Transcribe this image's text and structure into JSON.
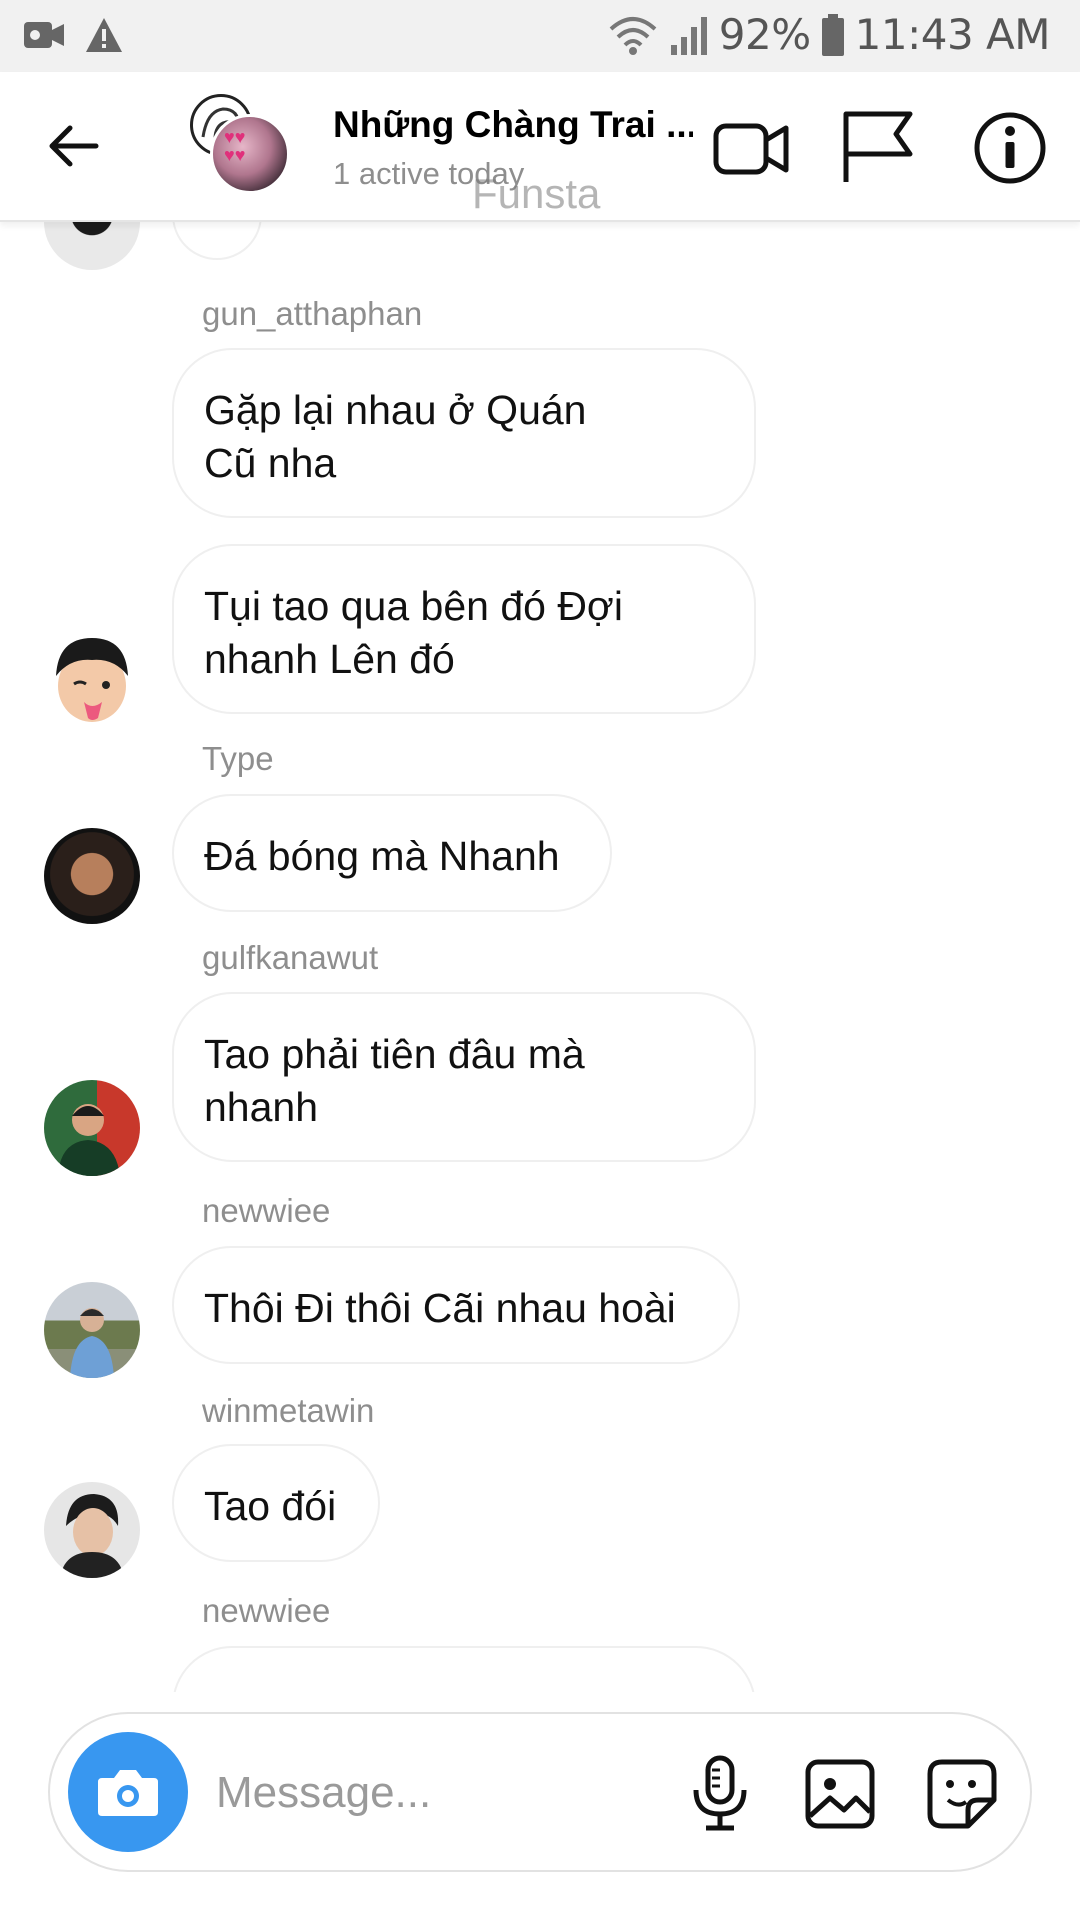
{
  "status_bar": {
    "battery_percent": "92%",
    "time": "11:43 AM",
    "left_icons": [
      "video-camera-icon",
      "warning-icon"
    ],
    "right_icons": [
      "wifi-icon",
      "signal-icon",
      "battery-icon"
    ]
  },
  "header": {
    "title": "Những Chàng Trai ...",
    "subtitle": "1 active today",
    "watermark": "Funsta",
    "icons": [
      "back-arrow-icon",
      "video-call-icon",
      "flag-icon",
      "info-icon"
    ]
  },
  "messages": [
    {
      "sender": "",
      "text": ""
    },
    {
      "sender": "gun_atthaphan",
      "lines": [
        "Gặp lại nhau ở Quán",
        "Cũ nha"
      ]
    },
    {
      "sender": "",
      "lines": [
        "Tụi tao qua bên đó Đợi",
        "nhanh Lên đó"
      ]
    },
    {
      "sender": "Type",
      "lines": [
        "Đá bóng mà Nhanh"
      ]
    },
    {
      "sender": "gulfkanawut",
      "lines": [
        "Tao phải tiên đâu mà",
        "nhanh"
      ]
    },
    {
      "sender": "newwiee",
      "lines": [
        "Thôi Đi thôi Cãi nhau hoài"
      ]
    },
    {
      "sender": "winmetawin",
      "lines": [
        "Tao đói"
      ]
    },
    {
      "sender": "newwiee",
      "lines": [
        ""
      ]
    }
  ],
  "composer": {
    "placeholder": "Message...",
    "icons": [
      "camera-icon",
      "microphone-icon",
      "gallery-icon",
      "sticker-icon"
    ]
  },
  "colors": {
    "accent": "#3897f0",
    "bubble_border": "#efefef",
    "sender_text": "#8e8e8e"
  }
}
